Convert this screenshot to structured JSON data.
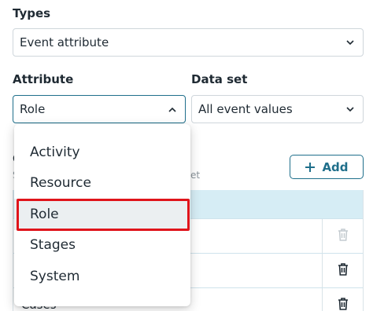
{
  "types": {
    "label": "Types",
    "value": "Event attribute"
  },
  "attribute": {
    "label": "Attribute",
    "value": "Role"
  },
  "dataset": {
    "label": "Data set",
    "value": "All event values"
  },
  "section": {
    "title_fragment": "C",
    "subtitle_start": "S",
    "subtitle_end": "et",
    "add_label": "Add"
  },
  "table": {
    "rows": [
      {
        "text": ""
      },
      {
        "text": ""
      },
      {
        "text": "Cases"
      }
    ]
  },
  "dropdown": {
    "items": [
      {
        "label": "Activity"
      },
      {
        "label": "Resource"
      },
      {
        "label": "Role"
      },
      {
        "label": "Stages"
      },
      {
        "label": "System"
      }
    ],
    "selected": "Role"
  },
  "colors": {
    "accent": "#1f6f8b",
    "highlight": "#e0141b",
    "table_header": "#d6edf5"
  }
}
